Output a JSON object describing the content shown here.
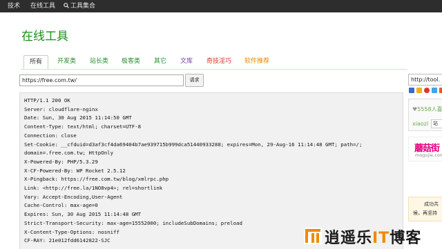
{
  "topnav": {
    "items": [
      "技术",
      "在线工具",
      "工具集合"
    ]
  },
  "page": {
    "title": "在线工具"
  },
  "tabs": [
    {
      "label": "所有",
      "color": "#333333"
    },
    {
      "label": "开发类",
      "color": "#2b8a2b"
    },
    {
      "label": "站长类",
      "color": "#2b8a2b"
    },
    {
      "label": "极客类",
      "color": "#2b8a2b"
    },
    {
      "label": "其它",
      "color": "#2b8a2b"
    },
    {
      "label": "文库",
      "color": "#7b3f9e"
    },
    {
      "label": "奇技淫巧",
      "color": "#d9342b"
    },
    {
      "label": "软件推荐",
      "color": "#e68a00"
    }
  ],
  "request": {
    "url_value": "https://free.com.tw/",
    "button_label": "请求"
  },
  "result": {
    "lines": [
      "HTTP/1.1 200 OK",
      "Server: cloudflare-nginx",
      "Date: Sun, 30 Aug 2015 11:14:50 GMT",
      "Content-Type: text/html; charset=UTF-8",
      "Connection: close",
      "Set-Cookie: __cfduid=d3af3cf4da69404b7ae939715b999dca51440933288; expires=Mon, 29-Aug-16 11:14:48 GMT; path=/;",
      "domain=.free.com.tw; HttpOnly",
      "X-Powered-By: PHP/5.3.29",
      "X-CF-Powered-By: WP Rocket 2.5.12",
      "X-Pingback: https://free.com.tw/blog/xmlrpc.php",
      "Link: <http://free.la/1NO8vp4>; rel=shortlink",
      "Vary: Accept-Encoding,User-Agent",
      "Cache-Control: max-age=0",
      "Expires: Sun, 30 Aug 2015 11:14:48 GMT",
      "Strict-Transport-Security: max-age=15552000; includeSubDomains; preload",
      "X-Content-Type-Options: nosniff",
      "CF-RAY: 21e012fdd6142822-SJC"
    ]
  },
  "sidebar": {
    "url_value": "http://tool.",
    "follower_count": "5558人喜",
    "user_name": "xiaozl",
    "follow_label": "站",
    "ad_title": "蘑菇街",
    "ad_sub": "mogujie.com",
    "notice_line1": "成功共",
    "notice_line2": "候，再坚持"
  },
  "watermark": {
    "text_a": "逍遥乐",
    "text_it": "IT",
    "text_b": "博客"
  },
  "colors": {
    "topbar_bg": "#2d2d2d",
    "title_green": "#1a8f1a",
    "result_bg": "#f1f1f1",
    "accent_orange": "#f08a00"
  }
}
